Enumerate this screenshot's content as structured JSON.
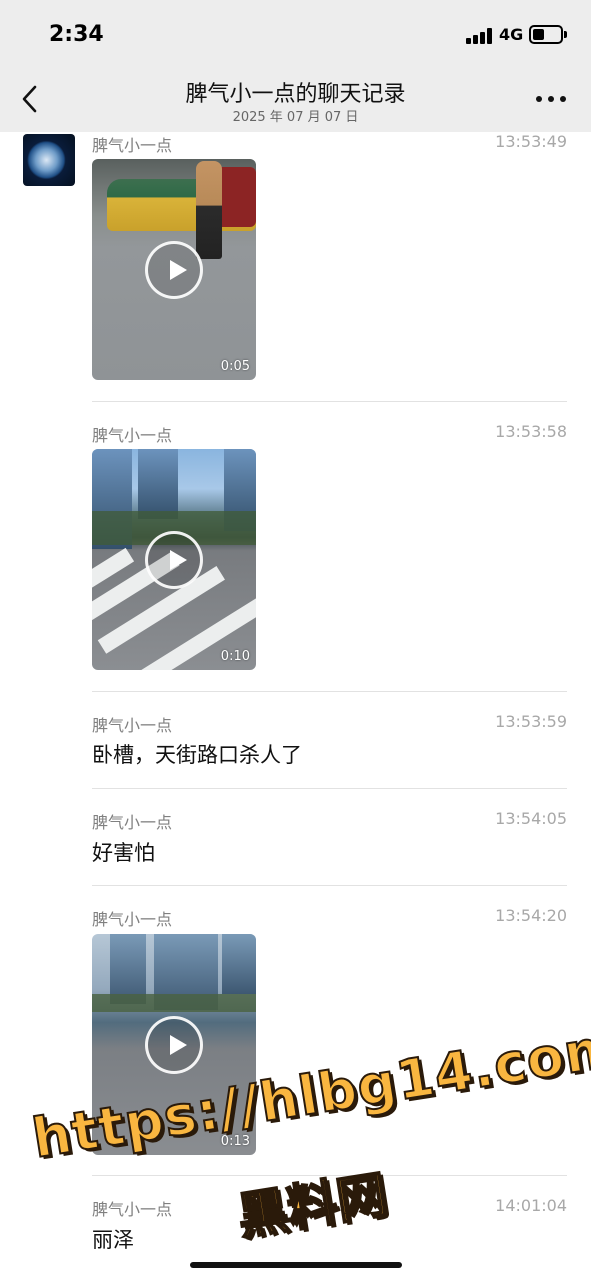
{
  "status_bar": {
    "time": "2:34",
    "network": "4G"
  },
  "nav": {
    "title": "脾气小一点的聊天记录",
    "subtitle": "2025 年 07 月 07 日",
    "back_icon": "chevron-left-icon",
    "more_icon": "ellipsis-icon"
  },
  "messages": [
    {
      "sender": "脾气小一点",
      "time": "13:53:49",
      "type": "video",
      "duration": "0:05"
    },
    {
      "sender": "脾气小一点",
      "time": "13:53:58",
      "type": "video",
      "duration": "0:10"
    },
    {
      "sender": "脾气小一点",
      "time": "13:53:59",
      "type": "text",
      "text": "卧槽，天街路口杀人了"
    },
    {
      "sender": "脾气小一点",
      "time": "13:54:05",
      "type": "text",
      "text": "好害怕"
    },
    {
      "sender": "脾气小一点",
      "time": "13:54:20",
      "type": "video",
      "duration": "0:13"
    },
    {
      "sender": "脾气小一点",
      "time": "14:01:04",
      "type": "text",
      "text": "丽泽"
    }
  ],
  "watermark": {
    "line1": "https://hlbg14.com",
    "line2": "黑料网"
  }
}
